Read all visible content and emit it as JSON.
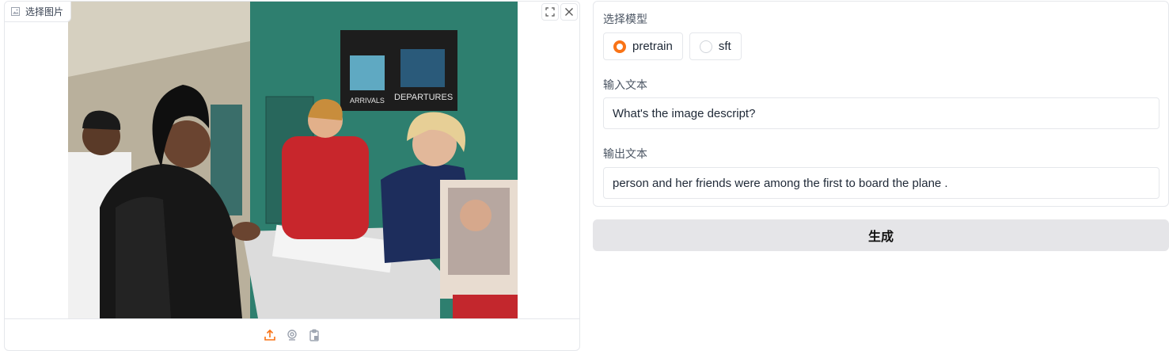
{
  "image_panel": {
    "label": "选择图片",
    "label_icon": "image-icon",
    "fullscreen_icon": "fullscreen-icon",
    "close_icon": "close-icon",
    "photo_signs": {
      "arrivals": "ARRIVALS",
      "departures": "DEPARTURES"
    },
    "sources": [
      {
        "icon": "upload-icon",
        "active": true
      },
      {
        "icon": "webcam-icon",
        "active": false
      },
      {
        "icon": "clipboard-icon",
        "active": false
      }
    ]
  },
  "form": {
    "model_label": "选择模型",
    "model_options": [
      {
        "label": "pretrain",
        "selected": true
      },
      {
        "label": "sft",
        "selected": false
      }
    ],
    "input_label": "输入文本",
    "input_value": "What's the image descript?",
    "output_label": "输出文本",
    "output_value": "person and her friends were among the first to board the plane ."
  },
  "generate_button": "生成",
  "colors": {
    "accent": "#f97316",
    "button_bg": "#e5e5e8",
    "border": "#e5e7eb"
  }
}
